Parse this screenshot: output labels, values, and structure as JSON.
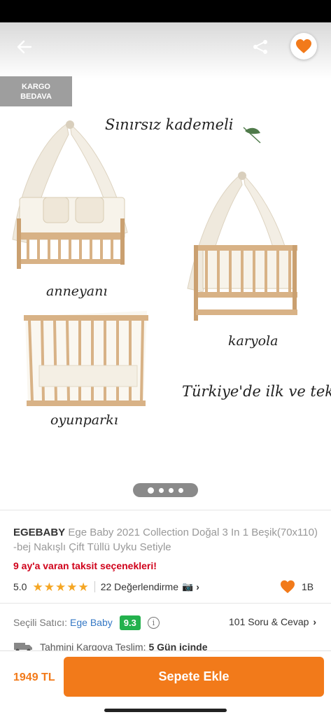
{
  "gallery": {
    "badge_line1": "KARGO",
    "badge_line2": "BEDAVA",
    "image_texts": {
      "headline": "Sınırsız kademeli",
      "anneyani": "anneyanı",
      "karyola": "karyola",
      "oyunparki": "oyunparkı",
      "turkiye": "Türkiye'de ilk ve tek"
    },
    "page_count": 4,
    "active_page": 1
  },
  "header_icons": {
    "back": "arrow-left-icon",
    "share": "share-icon",
    "favorite": "heart-icon"
  },
  "product": {
    "brand": "EGEBABY",
    "name": "Ege Baby 2021 Collection Doğal 3 In 1 Beşik(70x110) -bej Nakışlı Çift Tüllü Uyku Setiyle",
    "installments": "9 ay'a varan taksit seçenekleri!",
    "rating": "5.0",
    "stars": 5,
    "reviews": "22 Değerlendirme",
    "likes": "1B"
  },
  "seller": {
    "label": "Seçili Satıcı:",
    "name": "Ege Baby",
    "score": "9.3",
    "qa": "101 Soru & Cevap"
  },
  "delivery": {
    "label": "Tahmini Kargoya Teslim:",
    "value": "5 Gün içinde"
  },
  "bottom": {
    "price": "1949 TL",
    "cta": "Sepete Ekle"
  },
  "colors": {
    "accent": "#f27a1a",
    "star": "#f5a623",
    "installment": "#d0021b",
    "seller_link": "#3478c5",
    "score_badge": "#23b14d"
  }
}
